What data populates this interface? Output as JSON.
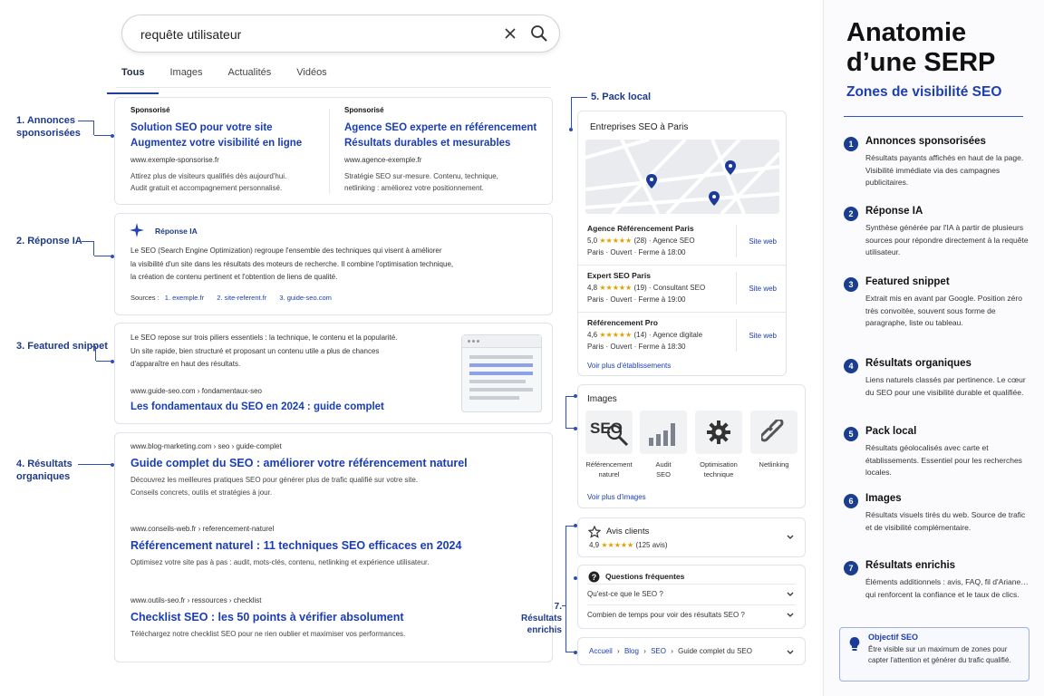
{
  "search": {
    "query": "requête utilisateur"
  },
  "tabs": [
    "Tous",
    "Images",
    "Actualités",
    "Vidéos"
  ],
  "ads": [
    {
      "badge": "Sponsorisé",
      "title1": "Solution SEO pour votre site",
      "title2": "Augmentez votre visibilité en ligne",
      "url": "www.exemple-sponsorise.fr",
      "desc1": "Attirez plus de visiteurs qualifiés dès aujourd'hui.",
      "desc2": "Audit gratuit et accompagnement personnalisé."
    },
    {
      "badge": "Sponsorisé",
      "title1": "Agence SEO experte en référencement",
      "title2": "Résultats durables et mesurables",
      "url": "www.agence-exemple.fr",
      "desc1": "Stratégie SEO sur-mesure. Contenu, technique,",
      "desc2": "netlinking : améliorez votre positionnement."
    }
  ],
  "ai": {
    "title": "Réponse IA",
    "l1": "Le SEO (Search Engine Optimization) regroupe l'ensemble des techniques qui visent à améliorer",
    "l2": "la visibilité d'un site dans les résultats des moteurs de recherche. Il combine l'optimisation technique,",
    "l3": "la création de contenu pertinent et l'obtention de liens de qualité.",
    "sources_label": "Sources :",
    "s1": "1. exemple.fr",
    "s2": "2. site-referent.fr",
    "s3": "3. guide-seo.com"
  },
  "snippet": {
    "l1": "Le SEO repose sur trois piliers essentiels : la technique, le contenu et la popularité.",
    "l2": "Un site rapide, bien structuré et proposant un contenu utile a plus de chances",
    "l3": "d'apparaître en haut des résultats.",
    "url": "www.guide-seo.com › fondamentaux-seo",
    "title": "Les fondamentaux du SEO en 2024 : guide complet"
  },
  "organic": [
    {
      "url": "www.blog-marketing.com › seo › guide-complet",
      "title": "Guide complet du SEO : améliorer votre référencement naturel",
      "d1": "Découvrez les meilleures pratiques SEO pour générer plus de trafic qualifié sur votre site.",
      "d2": "Conseils concrets, outils et stratégies à jour."
    },
    {
      "url": "www.conseils-web.fr › referencement-naturel",
      "title": "Référencement naturel : 11 techniques SEO efficaces en 2024",
      "d1": "Optimisez votre site pas à pas : audit, mots-clés, contenu, netlinking et expérience utilisateur.",
      "d2": ""
    },
    {
      "url": "www.outils-seo.fr › ressources › checklist",
      "title": "Checklist SEO : les 50 points à vérifier absolument",
      "d1": "Téléchargez notre checklist SEO pour ne rien oublier et maximiser vos performances.",
      "d2": ""
    }
  ],
  "labels": {
    "l1a": "1. Annonces",
    "l1b": "sponsorisées",
    "l2": "2. Réponse IA",
    "l3": "3. Featured snippet",
    "l4a": "4. Résultats",
    "l4b": "organiques",
    "l5": "5. Pack local",
    "l7a": "7. Résultats",
    "l7b": "enrichis"
  },
  "local": {
    "title": "Entreprises SEO à Paris",
    "site_label": "Site web",
    "more": "Voir plus d'établissements",
    "items": [
      {
        "name": "Agence Référencement Paris",
        "rating": "5,0",
        "stars": "★★★★★",
        "reviews": "(28)",
        "type": "· Agence SEO",
        "info": "Paris · Ouvert · Ferme à 18:00"
      },
      {
        "name": "Expert SEO Paris",
        "rating": "4,8",
        "stars": "★★★★★",
        "reviews": "(19)",
        "type": "· Consultant SEO",
        "info": "Paris · Ouvert · Ferme à 19:00"
      },
      {
        "name": "Référencement Pro",
        "rating": "4,6",
        "stars": "★★★★★",
        "reviews": "(14)",
        "type": "· Agence digitale",
        "info": "Paris · Ouvert · Ferme à 18:30"
      }
    ]
  },
  "images": {
    "title": "Images",
    "more": "Voir plus d'images",
    "seo_text": "SEO",
    "items": [
      {
        "c1": "Référencement",
        "c2": "naturel"
      },
      {
        "c1": "Audit",
        "c2": "SEO"
      },
      {
        "c1": "Optimisation",
        "c2": "technique"
      },
      {
        "c1": "Netlinking",
        "c2": ""
      }
    ]
  },
  "reviews": {
    "title": "Avis clients",
    "rating": "4,9",
    "stars": "★★★★★",
    "count": "(125 avis)"
  },
  "faq": {
    "title": "Questions fréquentes",
    "q1": "Qu'est-ce que le SEO ?",
    "q2": "Combien de temps pour voir des résultats SEO ?"
  },
  "breadcrumb": [
    "Accueil",
    "Blog",
    "SEO",
    "Guide complet du SEO"
  ],
  "panel": {
    "title1": "Anatomie",
    "title2": "d’une SERP",
    "subtitle": "Zones de visibilité SEO",
    "items": [
      {
        "n": "1",
        "t": "Annonces sponsorisées",
        "d": "Résultats payants affichés en haut de la page. Visibilité immédiate via des campagnes publicitaires."
      },
      {
        "n": "2",
        "t": "Réponse IA",
        "d": "Synthèse générée par l'IA à partir de plusieurs sources pour répondre directement à la requête utilisateur."
      },
      {
        "n": "3",
        "t": "Featured snippet",
        "d": "Extrait mis en avant par Google. Position zéro très convoitée, souvent sous forme de paragraphe, liste ou tableau."
      },
      {
        "n": "4",
        "t": "Résultats organiques",
        "d": "Liens naturels classés par pertinence. Le cœur du SEO pour une visibilité durable et qualifiée."
      },
      {
        "n": "5",
        "t": "Pack local",
        "d": "Résultats géolocalisés avec carte et établissements. Essentiel pour les recherches locales."
      },
      {
        "n": "6",
        "t": "Images",
        "d": "Résultats visuels tirés du web. Source de trafic et de visibilité complémentaire."
      },
      {
        "n": "7",
        "t": "Résultats enrichis",
        "d": "Éléments additionnels : avis, FAQ, fil d'Ariane… qui renforcent la confiance et le taux de clics."
      }
    ],
    "goal_title": "Objectif SEO",
    "goal_desc": "Être visible sur un maximum de zones pour capter l'attention et générer du trafic qualifié."
  }
}
